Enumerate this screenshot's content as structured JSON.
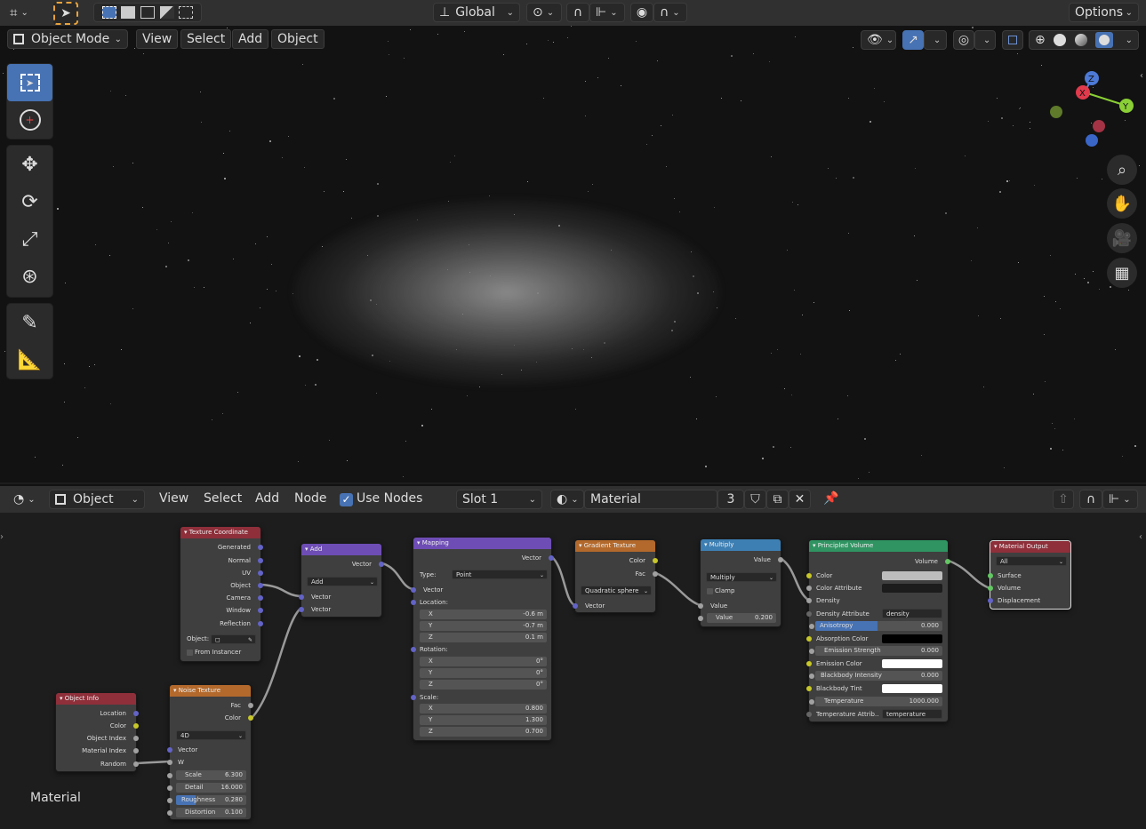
{
  "top_header": {
    "transform_orientation": "Global",
    "options_label": "Options"
  },
  "viewport_header": {
    "mode": "Object Mode",
    "menus": [
      "View",
      "Select",
      "Add",
      "Object"
    ]
  },
  "gizmo": {
    "x": "X",
    "y": "Y",
    "z": "Z"
  },
  "node_header": {
    "editor_type": "Object",
    "menus": [
      "View",
      "Select",
      "Add",
      "Node"
    ],
    "use_nodes_label": "Use Nodes",
    "slot": "Slot 1",
    "material": "Material",
    "users": "3"
  },
  "ne_label": "Material",
  "nodes": {
    "texcoord": {
      "title": "Texture Coordinate",
      "outputs": [
        "Generated",
        "Normal",
        "UV",
        "Object",
        "Camera",
        "Window",
        "Reflection"
      ],
      "object_label": "Object:",
      "from_instancer": "From Instancer"
    },
    "add": {
      "title": "Add",
      "out": "Vector",
      "op": "Add",
      "in1": "Vector",
      "in2": "Vector"
    },
    "mapping": {
      "title": "Mapping",
      "out": "Vector",
      "type_label": "Type:",
      "type": "Point",
      "in": "Vector",
      "location_label": "Location:",
      "rotation_label": "Rotation:",
      "scale_label": "Scale:",
      "loc": [
        {
          "a": "X",
          "v": "-0.6 m"
        },
        {
          "a": "Y",
          "v": "-0.7 m"
        },
        {
          "a": "Z",
          "v": "0.1 m"
        }
      ],
      "rot": [
        {
          "a": "X",
          "v": "0°"
        },
        {
          "a": "Y",
          "v": "0°"
        },
        {
          "a": "Z",
          "v": "0°"
        }
      ],
      "scl": [
        {
          "a": "X",
          "v": "0.800"
        },
        {
          "a": "Y",
          "v": "1.300"
        },
        {
          "a": "Z",
          "v": "0.700"
        }
      ]
    },
    "gradient": {
      "title": "Gradient Texture",
      "out1": "Color",
      "out2": "Fac",
      "type": "Quadratic sphere",
      "in": "Vector"
    },
    "multiply": {
      "title": "Multiply",
      "out": "Value",
      "op": "Multiply",
      "clamp": "Clamp",
      "in1": "Value",
      "in2_label": "Value",
      "in2_val": "0.200"
    },
    "volume": {
      "title": "Principled Volume",
      "out": "Volume",
      "rows": [
        {
          "label": "Color"
        },
        {
          "label": "Color Attribute"
        },
        {
          "label": "Density"
        },
        {
          "label": "Density Attribute",
          "val": "density"
        },
        {
          "label": "Anisotropy",
          "val": "0.000"
        },
        {
          "label": "Absorption Color"
        },
        {
          "label": "Emission Strength",
          "val": "0.000"
        },
        {
          "label": "Emission Color"
        },
        {
          "label": "Blackbody Intensity",
          "val": "0.000"
        },
        {
          "label": "Blackbody Tint"
        },
        {
          "label": "Temperature",
          "val": "1000.000"
        },
        {
          "label": "Temperature Attrib..",
          "val": "temperature"
        }
      ]
    },
    "output": {
      "title": "Material Output",
      "target": "All",
      "in1": "Surface",
      "in2": "Volume",
      "in3": "Displacement"
    },
    "objinfo": {
      "title": "Object Info",
      "outputs": [
        "Location",
        "Color",
        "Object Index",
        "Material Index",
        "Random"
      ]
    },
    "noise": {
      "title": "Noise Texture",
      "out1": "Fac",
      "out2": "Color",
      "dim": "4D",
      "in1": "Vector",
      "in2": "W",
      "fields": [
        {
          "a": "Scale",
          "v": "6.300"
        },
        {
          "a": "Detail",
          "v": "16.000"
        },
        {
          "a": "Roughness",
          "v": "0.280"
        },
        {
          "a": "Distortion",
          "v": "0.100"
        }
      ]
    }
  },
  "colors": {
    "accent": "#4772b3",
    "input_header": "#8e2f3a",
    "vector_header": "#6e4db5",
    "texture_header": "#b3692b",
    "converter_header": "#3d7fb3",
    "shader_header": "#2f9461",
    "output_header": "#8e2f3a"
  }
}
